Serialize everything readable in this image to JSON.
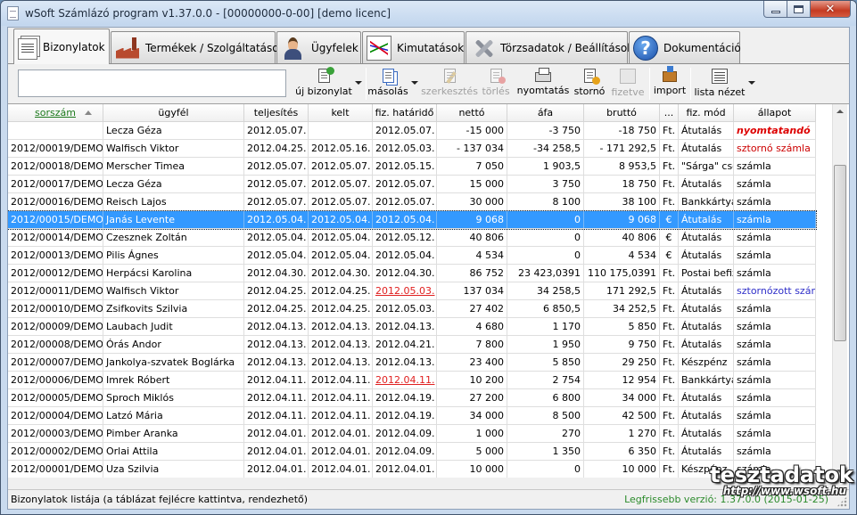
{
  "window": {
    "title": "wSoft Számlázó program v1.37.0.0 - [00000000-0-00] [demo licenc]"
  },
  "tabs": [
    {
      "label": "Bizonylatok",
      "icon": "documents-icon",
      "active": true
    },
    {
      "label": "Termékek / Szolgáltatások",
      "icon": "factory-icon"
    },
    {
      "label": "Ügyfelek",
      "icon": "person-icon"
    },
    {
      "label": "Kimutatások",
      "icon": "chart-icon"
    },
    {
      "label": "Törzsadatok / Beállítások",
      "icon": "tools-icon"
    },
    {
      "label": "Dokumentáció",
      "icon": "help-icon"
    }
  ],
  "toolbar": {
    "search_value": "",
    "new_label": "új bizonylat",
    "copy_label": "másolás",
    "edit_label": "szerkesztés",
    "delete_label": "törlés",
    "print_label": "nyomtatás",
    "storno_label": "stornó",
    "pay_label": "fizetve",
    "import_label": "import",
    "listview_label": "lista nézet"
  },
  "grid": {
    "headers": [
      "sorszám",
      "ügyfél",
      "teljesítés",
      "kelt",
      "fiz. határidő",
      "nettó",
      "áfa",
      "bruttó",
      "...",
      "fiz. mód",
      "állapot"
    ],
    "sorted_column": "sorszám",
    "rows": [
      [
        "",
        "Lecza Géza",
        "2012.05.07.",
        "",
        "2012.05.07.",
        "-15 000",
        "-3 750",
        "-18 750",
        "Ft.",
        "Átutalás",
        "nyomtatandó"
      ],
      [
        "2012/00019/DEMO",
        "Walfisch Viktor",
        "2012.04.25.",
        "2012.05.16.",
        "2012.05.03.",
        "- 137 034",
        "-34 258,5",
        "- 171 292,5",
        "Ft.",
        "Átutalás",
        "sztornó számla"
      ],
      [
        "2012/00018/DEMO",
        "Merscher Timea",
        "2012.05.07.",
        "2012.05.07.",
        "2012.05.15.",
        "7 050",
        "1 903,5",
        "8 953,5",
        "Ft.",
        "\"Sárga\" csekk",
        "számla"
      ],
      [
        "2012/00017/DEMO",
        "Lecza Géza",
        "2012.05.07.",
        "2012.05.07.",
        "2012.05.07.",
        "15 000",
        "3 750",
        "18 750",
        "Ft.",
        "Átutalás",
        "számla"
      ],
      [
        "2012/00016/DEMO",
        "Reisch Lajos",
        "2012.05.07.",
        "2012.05.07.",
        "2012.05.07.",
        "30 000",
        "8 100",
        "38 100",
        "Ft.",
        "Bankkártya",
        "számla"
      ],
      [
        "2012/00015/DEMO",
        "Janás Levente",
        "2012.05.04.",
        "2012.05.04.",
        "2012.05.04.",
        "9 068",
        "0",
        "9 068",
        "€",
        "Átutalás",
        "számla"
      ],
      [
        "2012/00014/DEMO",
        "Czesznek Zoltán",
        "2012.05.04.",
        "2012.05.04.",
        "2012.05.12.",
        "40 806",
        "0",
        "40 806",
        "€",
        "Átutalás",
        "számla"
      ],
      [
        "2012/00013/DEMO",
        "Pilis Ágnes",
        "2012.05.04.",
        "2012.05.04.",
        "2012.05.04.",
        "4 534",
        "0",
        "4 534",
        "€",
        "Átutalás",
        "számla"
      ],
      [
        "2012/00012/DEMO",
        "Herpácsi Karolina",
        "2012.04.30.",
        "2012.04.30.",
        "2012.04.30.",
        "86 752",
        "23 423,0391",
        "110 175,0391",
        "Ft.",
        "Postai befizetés",
        "számla"
      ],
      [
        "2012/00011/DEMO",
        "Walfisch Viktor",
        "2012.04.25.",
        "2012.04.25.",
        "2012.05.03.",
        "137 034",
        "34 258,5",
        "171 292,5",
        "Ft.",
        "Átutalás",
        "sztornózott számla"
      ],
      [
        "2012/00010/DEMO",
        "Zsifkovits Szilvia",
        "2012.04.25.",
        "2012.04.25.",
        "2012.05.03.",
        "27 402",
        "6 850,5",
        "34 252,5",
        "Ft.",
        "Átutalás",
        "számla"
      ],
      [
        "2012/00009/DEMO",
        "Laubach Judit",
        "2012.04.13.",
        "2012.04.13.",
        "2012.04.13.",
        "4 680",
        "1 170",
        "5 850",
        "Ft.",
        "Átutalás",
        "számla"
      ],
      [
        "2012/00008/DEMO",
        "Órás Andor",
        "2012.04.13.",
        "2012.04.13.",
        "2012.04.21.",
        "7 800",
        "1 950",
        "9 750",
        "Ft.",
        "Átutalás",
        "számla"
      ],
      [
        "2012/00007/DEMO",
        "Jankolya-szvatek Boglárka",
        "2012.04.13.",
        "2012.04.13.",
        "2012.04.13.",
        "23 400",
        "5 850",
        "29 250",
        "Ft.",
        "Készpénz",
        "számla"
      ],
      [
        "2012/00006/DEMO",
        "Imrek Róbert",
        "2012.04.11.",
        "2012.04.11.",
        "2012.04.11.",
        "10 200",
        "2 754",
        "12 954",
        "Ft.",
        "Bankkártya",
        "számla"
      ],
      [
        "2012/00005/DEMO",
        "Sproch Miklós",
        "2012.04.11.",
        "2012.04.11.",
        "2012.04.19.",
        "27 200",
        "6 800",
        "34 000",
        "Ft.",
        "Átutalás",
        "számla"
      ],
      [
        "2012/00004/DEMO",
        "Latzó Mária",
        "2012.04.11.",
        "2012.04.11.",
        "2012.04.19.",
        "34 000",
        "8 500",
        "42 500",
        "Ft.",
        "Átutalás",
        "számla"
      ],
      [
        "2012/00003/DEMO",
        "Pimber Aranka",
        "2012.04.01.",
        "2012.04.01.",
        "2012.04.09.",
        "1 000",
        "270",
        "1 270",
        "Ft.",
        "Átutalás",
        "számla"
      ],
      [
        "2012/00002/DEMO",
        "Orlai Attila",
        "2012.04.01.",
        "2012.04.01.",
        "2012.04.09.",
        "5 000",
        "1 350",
        "6 350",
        "Ft.",
        "Átutalás",
        "számla"
      ],
      [
        "2012/00001/DEMO",
        "Uza Szilvia",
        "2012.04.01.",
        "2012.04.01.",
        "2012.04.01.",
        "10 000",
        "0",
        "10 000",
        "Ft.",
        "Készpénz",
        "számla"
      ]
    ],
    "selected_row": 5,
    "overdue_cells": [
      [
        9,
        4
      ],
      [
        14,
        4
      ]
    ],
    "status_styles": {
      "0": "st-red",
      "1": "st-storno",
      "9": "st-stornod"
    }
  },
  "statusbar": {
    "left": "Bizonylatok listája (a táblázat fejlécre kattintva, rendezhető)",
    "right": "Legfrissebb verzió: 1.37.0.0 (2015-01-25)"
  },
  "watermark": {
    "brand": "tesztadatok",
    "url": "http://www.wsoft.hu"
  },
  "colors": {
    "selection": "#3399ff",
    "sorted_header": "#1d7a1d",
    "overdue": "#e02020",
    "status_ok": "#2a8a2a"
  }
}
